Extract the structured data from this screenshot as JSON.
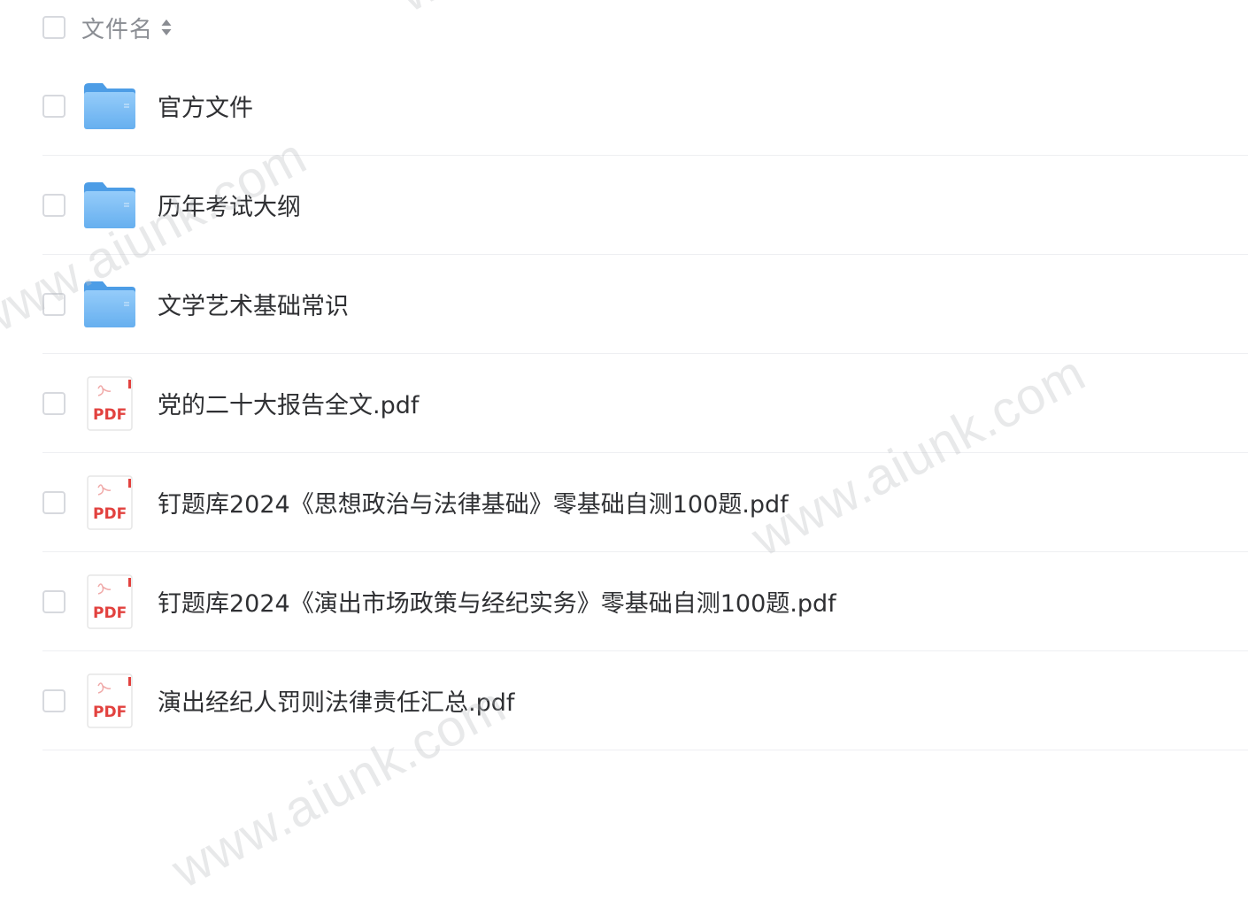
{
  "header": {
    "column_label": "文件名",
    "sort_icon": "sort-updown-icon"
  },
  "files": [
    {
      "name": "官方文件",
      "type": "folder",
      "icon": "folder-icon"
    },
    {
      "name": "历年考试大纲",
      "type": "folder",
      "icon": "folder-icon"
    },
    {
      "name": "文学艺术基础常识",
      "type": "folder",
      "icon": "folder-icon"
    },
    {
      "name": "党的二十大报告全文.pdf",
      "type": "pdf",
      "icon": "pdf-icon",
      "icon_label": "PDF"
    },
    {
      "name": "钉题库2024《思想政治与法律基础》零基础自测100题.pdf",
      "type": "pdf",
      "icon": "pdf-icon",
      "icon_label": "PDF"
    },
    {
      "name": "钉题库2024《演出市场政策与经纪实务》零基础自测100题.pdf",
      "type": "pdf",
      "icon": "pdf-icon",
      "icon_label": "PDF"
    },
    {
      "name": "演出经纪人罚则法律责任汇总.pdf",
      "type": "pdf",
      "icon": "pdf-icon",
      "icon_label": "PDF"
    }
  ],
  "watermark": {
    "text": "www.aiunk.com"
  },
  "colors": {
    "folder_blue": "#6fb7f5",
    "pdf_red": "#e2423f",
    "divider": "#eeeff2",
    "checkbox_border": "#d7d9de"
  }
}
